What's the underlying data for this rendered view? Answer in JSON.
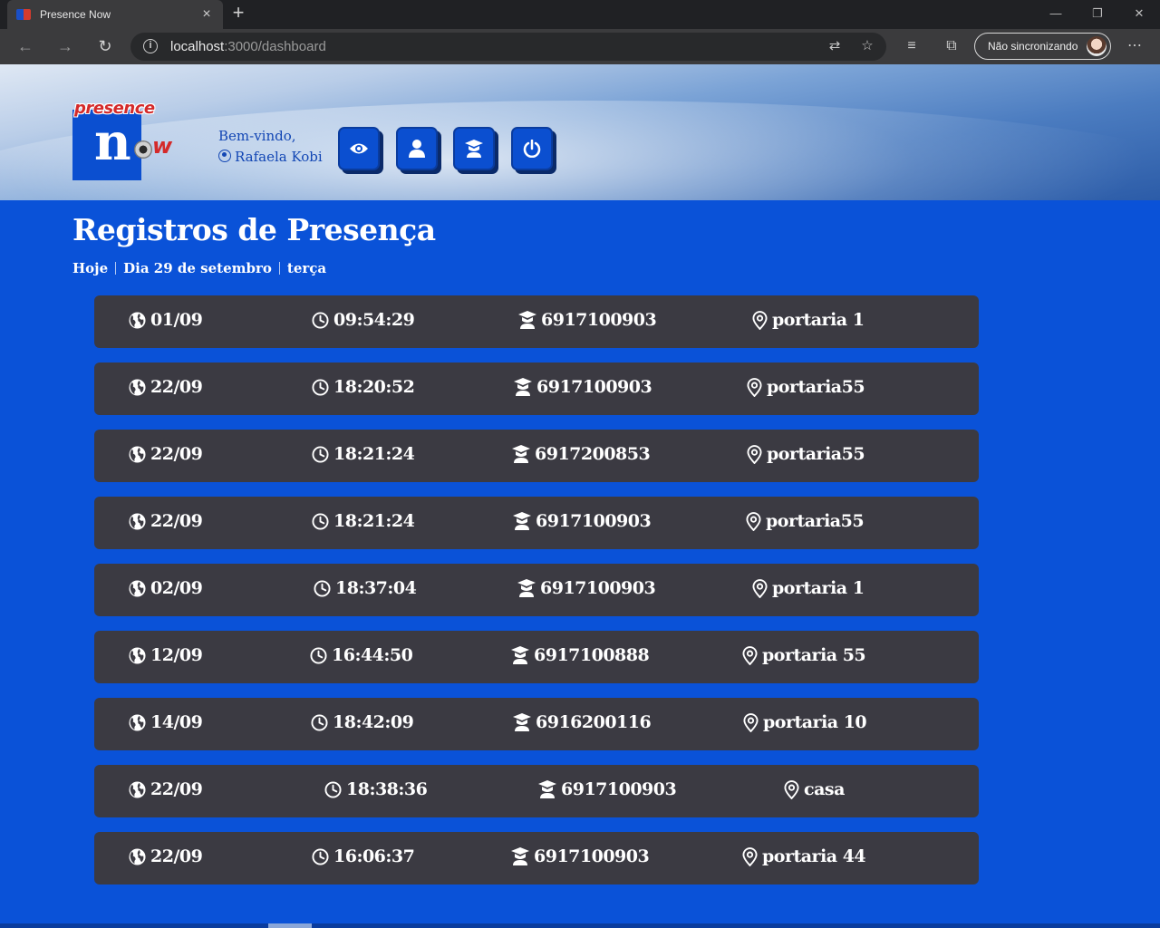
{
  "browser": {
    "tab_title": "Presence Now",
    "url_host": "localhost",
    "url_path": ":3000/dashboard",
    "sync_label": "Não sincronizando"
  },
  "header": {
    "logo_top": "presence",
    "logo_n": "n",
    "logo_w": "w",
    "welcome": "Bem-vindo,",
    "user_name": "Rafaela Kobi",
    "buttons": [
      "eye-icon",
      "user-icon",
      "graduate-icon",
      "power-icon"
    ]
  },
  "main": {
    "title": "Registros de Presença",
    "breadcrumb": [
      "Hoje",
      "Dia 29 de setembro",
      "terça"
    ]
  },
  "records": [
    {
      "date": "01/09",
      "time": "09:54:29",
      "id": "6917100903",
      "place": "portaria 1"
    },
    {
      "date": "22/09",
      "time": "18:20:52",
      "id": "6917100903",
      "place": "portaria55"
    },
    {
      "date": "22/09",
      "time": "18:21:24",
      "id": "6917200853",
      "place": "portaria55"
    },
    {
      "date": "22/09",
      "time": "18:21:24",
      "id": "6917100903",
      "place": "portaria55"
    },
    {
      "date": "02/09",
      "time": "18:37:04",
      "id": "6917100903",
      "place": "portaria 1"
    },
    {
      "date": "12/09",
      "time": "16:44:50",
      "id": "6917100888",
      "place": "portaria 55"
    },
    {
      "date": "14/09",
      "time": "18:42:09",
      "id": "6916200116",
      "place": "portaria 10"
    },
    {
      "date": "22/09",
      "time": "18:38:36",
      "id": "6917100903",
      "place": "casa"
    },
    {
      "date": "22/09",
      "time": "16:06:37",
      "id": "6917100903",
      "place": "portaria 44"
    }
  ],
  "colors": {
    "page_bg": "#0a52d8",
    "card_bg": "#3b3a42",
    "button_bg": "#0b4fd0",
    "accent_red": "#d42a2a"
  }
}
